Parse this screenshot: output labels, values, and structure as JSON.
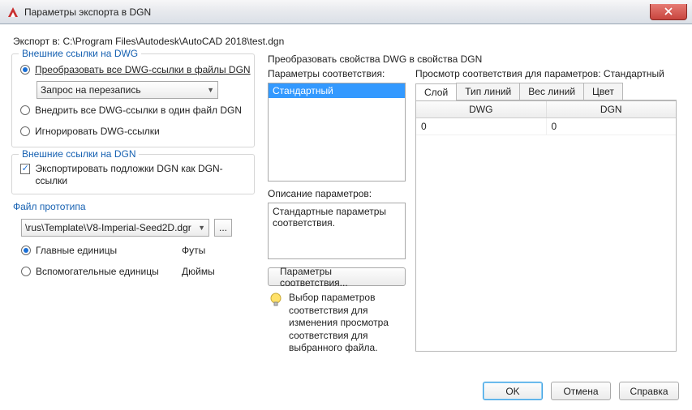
{
  "window": {
    "title": "Параметры экспорта в DGN"
  },
  "export_path": {
    "prefix": "Экспорт в: ",
    "value": "C:\\Program Files\\Autodesk\\AutoCAD 2018\\test.dgn"
  },
  "dwg_refs": {
    "legend": "Внешние ссылки на DWG",
    "opt_translate": "Преобразовать все DWG-ссылки в файлы DGN",
    "overwrite_combo": "Запрос на перезапись",
    "opt_bind": "Внедрить все DWG-ссылки в один файл DGN",
    "opt_ignore": "Игнорировать DWG-ссылки"
  },
  "dgn_refs": {
    "legend": "Внешние ссылки на DGN",
    "checkbox": "Экспортировать подложки DGN как DGN-ссылки"
  },
  "seedfile": {
    "legend": "Файл прототипа",
    "combo": "\\rus\\Template\\V8-Imperial-Seed2D.dgr",
    "browse": "...",
    "master_label": "Главные единицы",
    "master_unit": "Футы",
    "sub_label": "Вспомогательные единицы",
    "sub_unit": "Дюймы"
  },
  "mapping": {
    "heading": "Преобразовать свойства DWG в свойства DGN",
    "setups_label": "Параметры соответствия:",
    "setup_item": "Стандартный",
    "desc_label": "Описание параметров:",
    "desc_value": "Стандартные параметры соответствия.",
    "setups_btn": "Параметры соответствия...",
    "hint": "Выбор параметров соответствия для изменения просмотра соответствия для выбранного файла."
  },
  "preview": {
    "label_prefix": "Просмотр соответствия для параметров: ",
    "label_suffix": "Стандартный",
    "tabs": {
      "layer": "Слой",
      "linetype": "Тип линий",
      "lineweight": "Вес линий",
      "color": "Цвет"
    },
    "columns": {
      "dwg": "DWG",
      "dgn": "DGN"
    },
    "rows": [
      {
        "dwg": "0",
        "dgn": "0"
      }
    ]
  },
  "buttons": {
    "ok": "OK",
    "cancel": "Отмена",
    "help": "Справка"
  }
}
